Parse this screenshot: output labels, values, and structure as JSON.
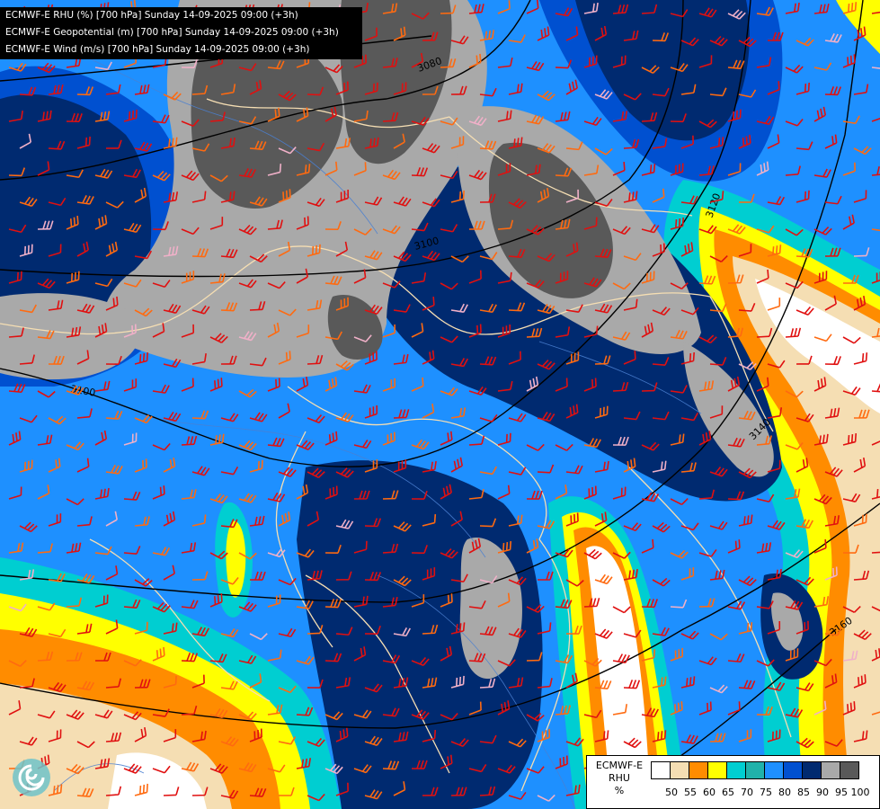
{
  "header": {
    "line1": "ECMWF-E RHU (%) [700 hPa] Sunday 14-09-2025 09:00 (+3h)",
    "line2": "ECMWF-E Geopotential (m) [700 hPa] Sunday 14-09-2025 09:00 (+3h)",
    "line3": "ECMWF-E Wind (m/s) [700 hPa] Sunday 14-09-2025 09:00 (+3h)"
  },
  "legend": {
    "title_line1": "ECMWF-E",
    "title_line2": "RHU",
    "title_line3": "%",
    "ticks": [
      "50",
      "55",
      "60",
      "65",
      "70",
      "75",
      "80",
      "85",
      "90",
      "95",
      "100"
    ],
    "colors": [
      "#ffffff",
      "#f5deb3",
      "#ff8c00",
      "#ffff00",
      "#00ced1",
      "#20b2aa",
      "#1e90ff",
      "#0050d0",
      "#002a70",
      "#a9a9a9",
      "#595959"
    ]
  },
  "contours": [
    {
      "label": "3080"
    },
    {
      "label": "3100"
    },
    {
      "label": "3100"
    },
    {
      "label": "3120"
    },
    {
      "label": "3140"
    },
    {
      "label": "3160"
    }
  ],
  "colors": {
    "contour": "#000000",
    "borders": "#f5deb3",
    "rivers": "#4a7fd0",
    "barb_red": "#e01010",
    "barb_orange": "#ff6a10",
    "barb_pink": "#f0b0c8"
  },
  "icons": [
    "ecmwf-logo-icon",
    "wind-barb-icon"
  ]
}
